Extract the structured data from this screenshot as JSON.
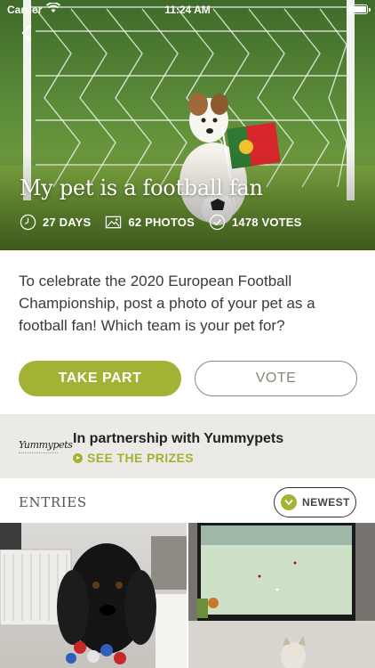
{
  "status_bar": {
    "carrier": "Carrier",
    "time": "11:24 AM"
  },
  "hero": {
    "title": "My pet is a football fan",
    "stats": [
      {
        "icon": "clock-icon",
        "label": "27 DAYS"
      },
      {
        "icon": "photo-icon",
        "label": "62 PHOTOS"
      },
      {
        "icon": "check-circle-icon",
        "label": "1478 VOTES"
      }
    ]
  },
  "description": "To celebrate the 2020 European Football Championship, post a photo of your pet as a football fan! Which team is your pet for?",
  "actions": {
    "take_part": "TAKE PART",
    "vote": "VOTE"
  },
  "partnership": {
    "logo_text": "Yummypets",
    "title": "In partnership with Yummypets",
    "link": "SEE THE PRIZES"
  },
  "entries": {
    "label": "ENTRIES",
    "sort": "NEWEST"
  },
  "colors": {
    "accent": "#a3b234",
    "outline": "#8c8677",
    "partner_bg": "#eceae6"
  }
}
